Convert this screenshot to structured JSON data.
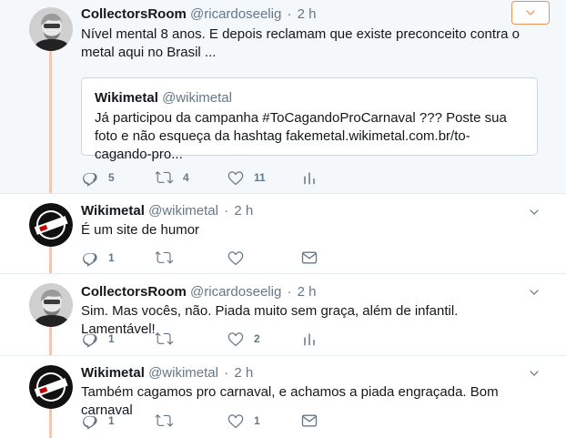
{
  "colors": {
    "accent": "#e8925c",
    "thread": "#f5c5b2",
    "muted": "#657786"
  },
  "tweets": [
    {
      "name": "CollectorsRoom",
      "handle": "@ricardoseelig",
      "dot": "·",
      "time": "2 h",
      "text": "Nível mental 8 anos. E depois reclamam que existe preconceito contra o metal aqui no Brasil ...",
      "quote": {
        "name": "Wikimetal",
        "handle": "@wikimetal",
        "text": "Já participou da campanha #ToCagandoProCarnaval ??? Poste sua foto e não esqueça da hashtag fakemetal.wikimetal.com.br/to-cagando-pro..."
      },
      "replies": "5",
      "retweets": "4",
      "likes": "11"
    },
    {
      "name": "Wikimetal",
      "handle": "@wikimetal",
      "dot": "·",
      "time": "2 h",
      "text": "É um site de humor",
      "replies": "1",
      "retweets": "",
      "likes": ""
    },
    {
      "name": "CollectorsRoom",
      "handle": "@ricardoseelig",
      "dot": "·",
      "time": "2 h",
      "text": "Sim. Mas vocês, não. Piada muito sem graça, além de infantil. Lamentável!",
      "replies": "1",
      "retweets": "",
      "likes": "2"
    },
    {
      "name": "Wikimetal",
      "handle": "@wikimetal",
      "dot": "·",
      "time": "2 h",
      "text": "Também cagamos pro carnaval, e achamos a piada engraçada. Bom carnaval",
      "replies": "1",
      "retweets": "",
      "likes": "1"
    }
  ]
}
